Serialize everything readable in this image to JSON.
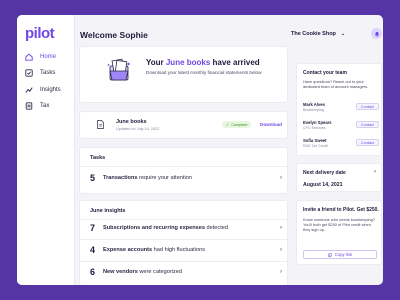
{
  "app": {
    "logo": "pilot"
  },
  "sidebar": {
    "items": [
      {
        "label": "Home",
        "icon": "home-icon",
        "active": true
      },
      {
        "label": "Tasks",
        "icon": "tasks-icon"
      },
      {
        "label": "Insights",
        "icon": "insights-icon"
      },
      {
        "label": "Tax",
        "icon": "tax-icon"
      }
    ]
  },
  "header": {
    "welcome": "Welcome Sophie",
    "shop": "The Cookie Shop",
    "shop_chevron": "⌄",
    "avatar_icon": "bell-icon"
  },
  "hero": {
    "title_prefix": "Your ",
    "title_highlight": "June books",
    "title_suffix": " have arrived",
    "subtitle": "Download your latest monthly financial statements below"
  },
  "books": {
    "title": "June books",
    "updated": "Updated on July 14, 2022",
    "status": "Complete",
    "download": "Download"
  },
  "tasks": {
    "title": "Tasks",
    "items": [
      {
        "num": "5",
        "bold": "Transactions",
        "text": " require your attention"
      }
    ]
  },
  "insights": {
    "title": "June insights",
    "items": [
      {
        "num": "7",
        "bold": "Subscriptions and recurring expenses",
        "text": " detected"
      },
      {
        "num": "4",
        "bold": "Expense accounts",
        "text": " had high fluctuations"
      },
      {
        "num": "6",
        "bold": "New vendors",
        "text": " were categorized"
      }
    ]
  },
  "contact": {
    "title": "Contact your team",
    "description": "Have questions? Reach out to your dedicated team of account managers.",
    "people": [
      {
        "name": "Mark Alves",
        "role": "Bookkeeping",
        "action": "Contact"
      },
      {
        "name": "Evelyn Spears",
        "role": "CFO Services",
        "action": "Contact"
      },
      {
        "name": "Sofia Sweet",
        "role": "R&D Tax Credit",
        "action": "Contact"
      }
    ]
  },
  "delivery": {
    "title": "Next delivery date",
    "date": "August 14, 2021"
  },
  "invite": {
    "title": "Invite a friend to Pilot. Get $250.",
    "description": "Know someone who needs bookkeeping? You'll both get $250 of Pilot credit when they sign up.",
    "button": "Copy link"
  },
  "colors": {
    "accent": "#6f47e6",
    "background": "#5534a5",
    "success": "#3c8b2d"
  }
}
